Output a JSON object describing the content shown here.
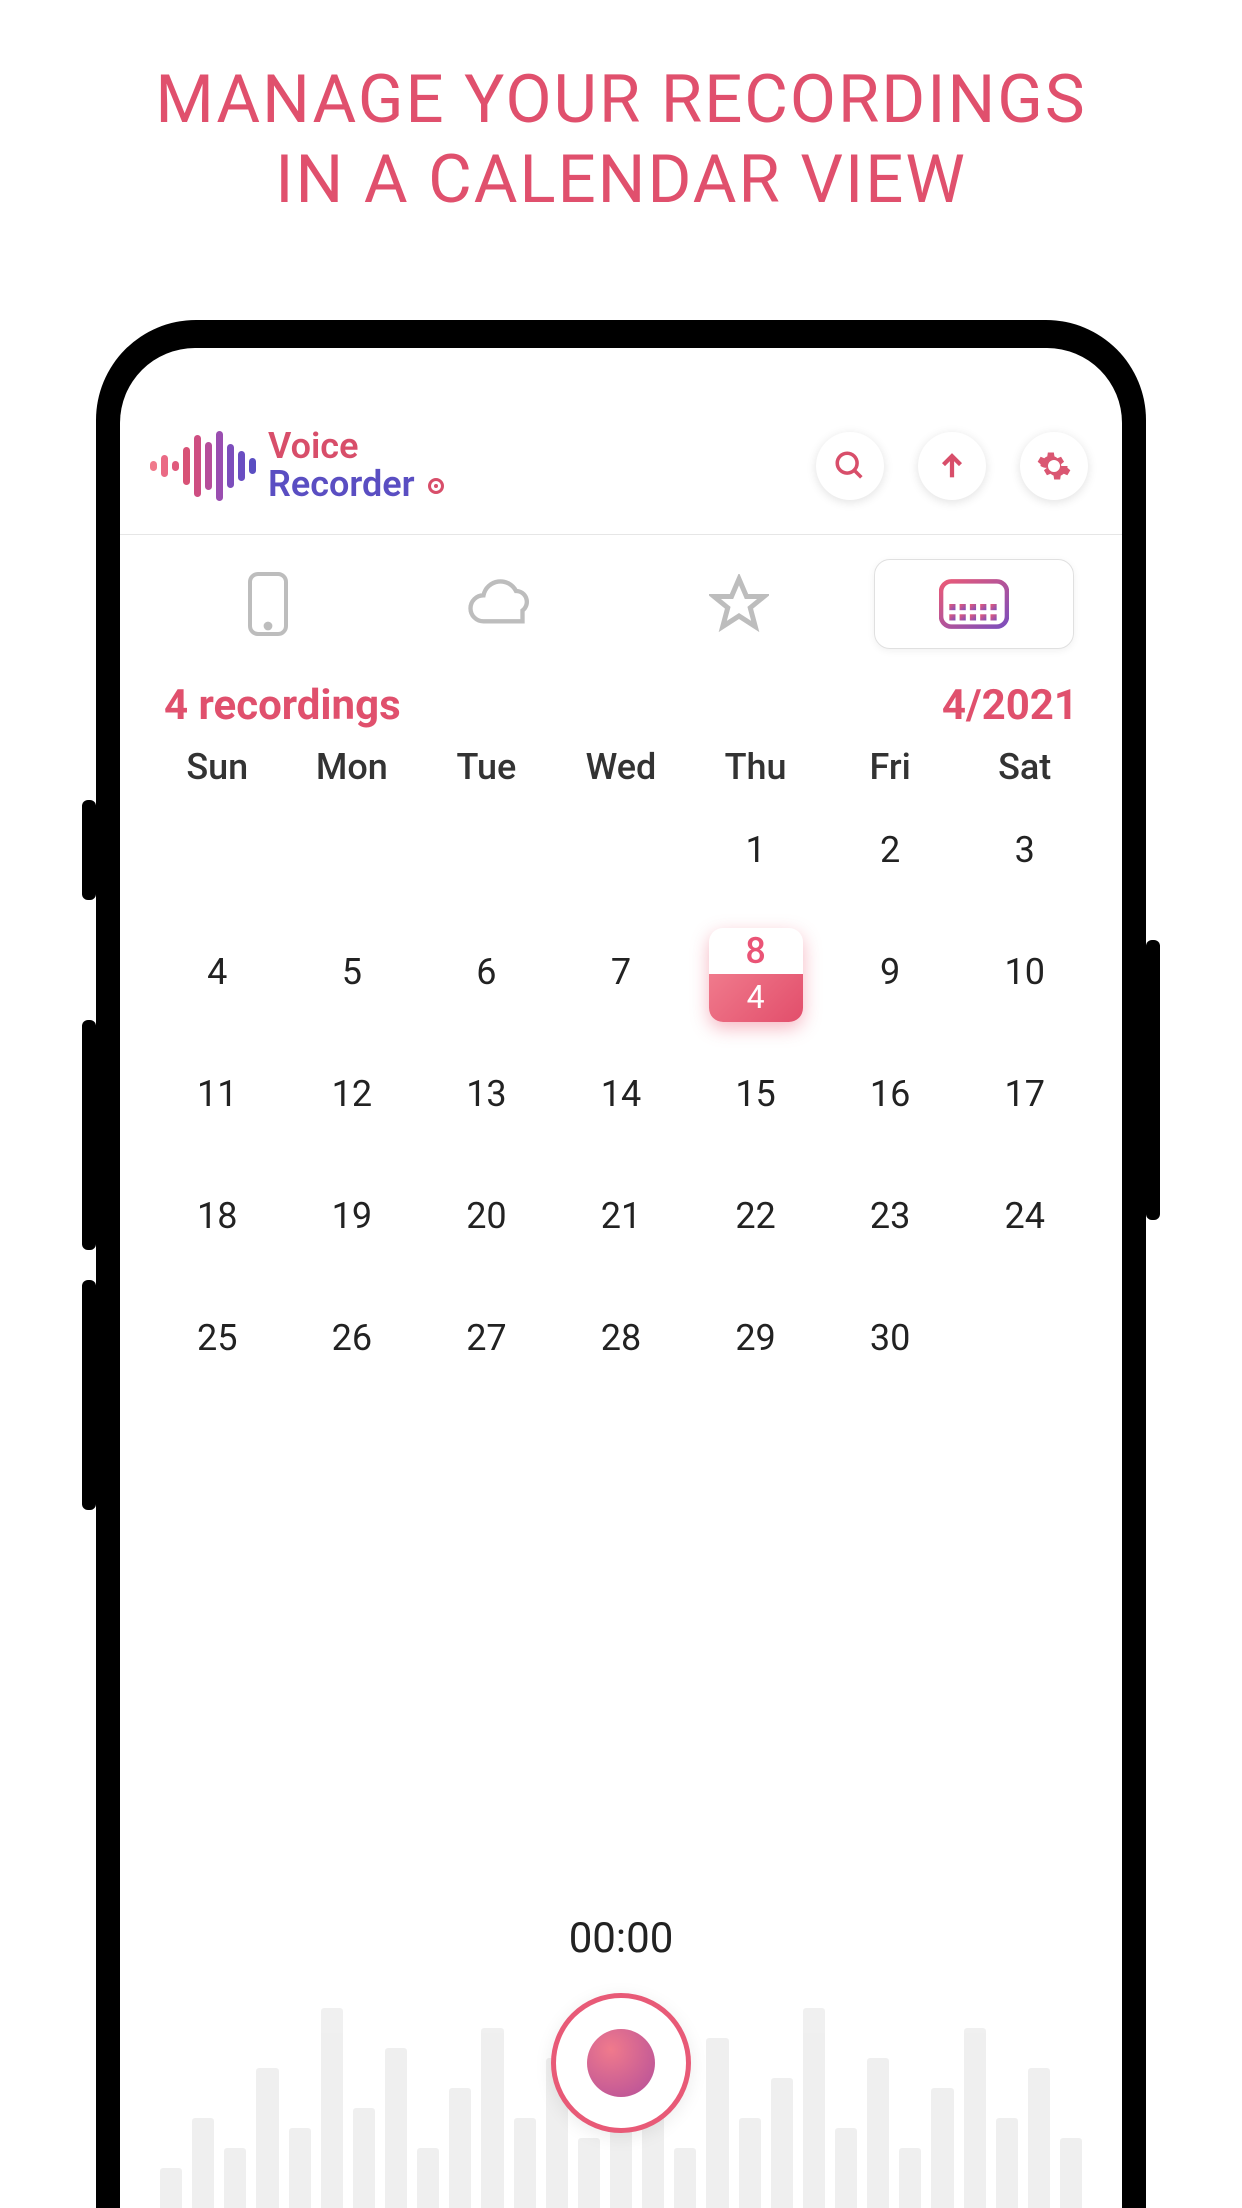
{
  "promo": {
    "line1": "MANAGE YOUR RECORDINGS",
    "line2": "IN A CALENDAR VIEW"
  },
  "logo": {
    "line1": "Voice",
    "line2": "Recorder"
  },
  "subheader": {
    "recordings": "4 recordings",
    "month": "4/2021"
  },
  "weekdays": [
    "Sun",
    "Mon",
    "Tue",
    "Wed",
    "Thu",
    "Fri",
    "Sat"
  ],
  "calendar": {
    "leading_blanks": 4,
    "days": 30,
    "selected_day": 8,
    "selected_count": "4"
  },
  "recorder": {
    "timer": "00:00"
  }
}
